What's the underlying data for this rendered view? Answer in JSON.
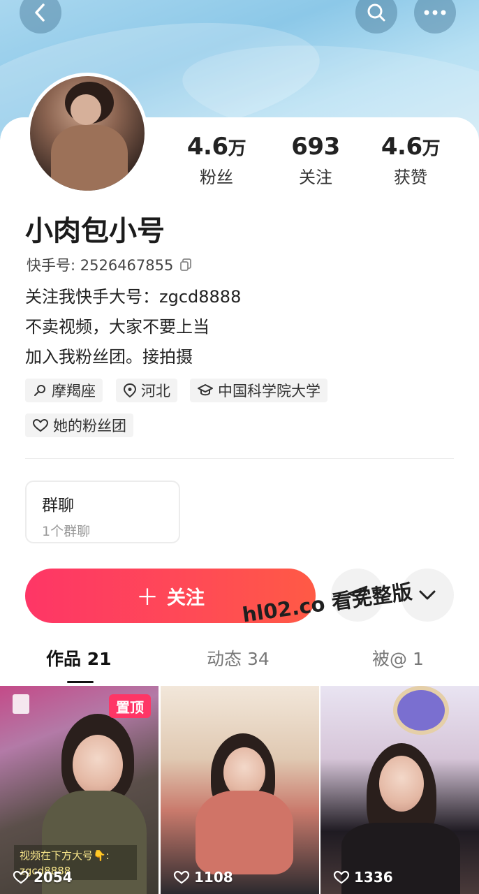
{
  "header": {
    "back_icon": "back-arrow-icon",
    "search_icon": "search-icon",
    "more_icon": "more-dots-icon"
  },
  "profile": {
    "stats": [
      {
        "number": "4.6",
        "unit": "万",
        "label": "粉丝"
      },
      {
        "number": "693",
        "unit": "",
        "label": "关注"
      },
      {
        "number": "4.6",
        "unit": "万",
        "label": "获赞"
      }
    ],
    "nickname": "小肉包小号",
    "uid_label": "快手号: 2526467855",
    "bio_lines": [
      "关注我快手大号：zgcd8888",
      "不卖视频，大家不要上当",
      "加入我粉丝团。接拍摄"
    ],
    "tags": [
      "摩羯座",
      "河北",
      "中国科学院大学",
      "她的粉丝团"
    ]
  },
  "group_chat": {
    "title": "群聊",
    "subtitle": "1个群聊"
  },
  "actions": {
    "follow_label": "关注",
    "follow_prefix": "＋"
  },
  "watermark": "hl02.co 看完整版",
  "tabs": [
    {
      "label": "作品 21",
      "active": true
    },
    {
      "label": "动态 34",
      "active": false
    },
    {
      "label": "被@ 1",
      "active": false
    }
  ],
  "videos": [
    {
      "likes": "2054",
      "badge": "置顶",
      "caption_line1": "视频在下方大号👇:",
      "caption_line2": "zgcd8888"
    },
    {
      "likes": "1108"
    },
    {
      "likes": "1336"
    }
  ],
  "colors": {
    "accent": "#fe3666",
    "header_bg": "#a9d7ef"
  }
}
